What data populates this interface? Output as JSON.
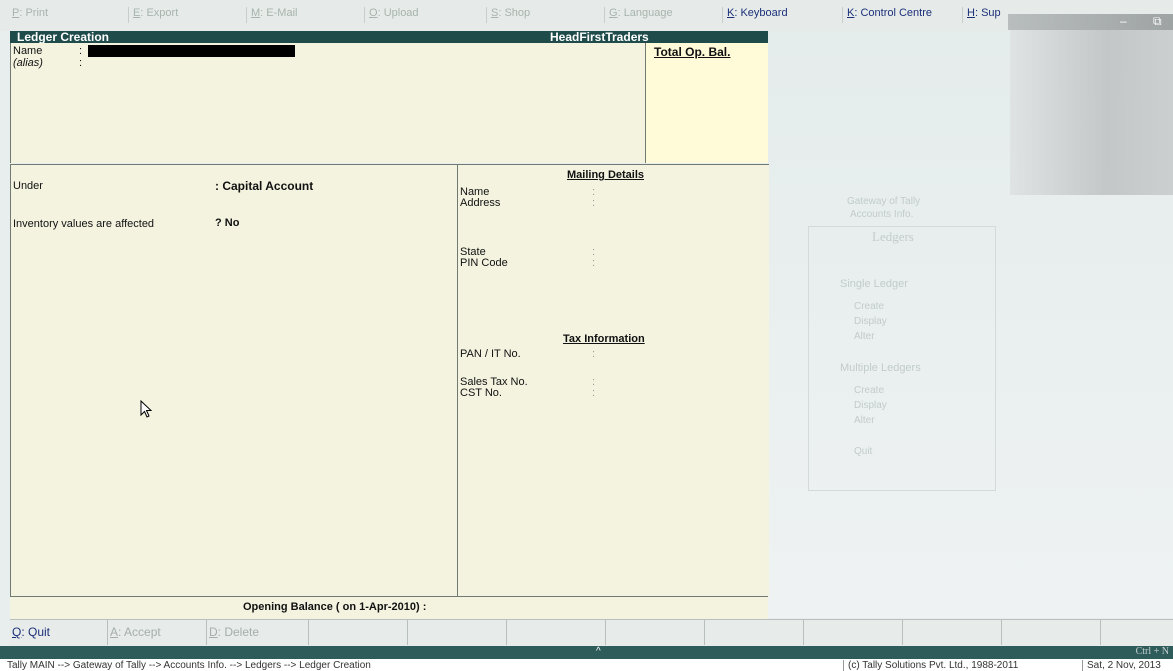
{
  "top_menu": [
    {
      "key": "P",
      "text": "Print"
    },
    {
      "key": "E",
      "text": "Export"
    },
    {
      "key": "M",
      "text": "E-Mail"
    },
    {
      "key": "O",
      "text": "Upload"
    },
    {
      "key": "S",
      "text": "Shop"
    },
    {
      "key": "G",
      "text": "Language"
    },
    {
      "key": "K",
      "text": "Keyboard"
    },
    {
      "key": "K",
      "text": "Control Centre"
    },
    {
      "key": "H",
      "text": "Sup"
    }
  ],
  "window": {
    "minimize": "–",
    "restore": "⧉"
  },
  "title": {
    "screen": "Ledger Creation",
    "company": "HeadFirstTraders"
  },
  "form": {
    "name_label": "Name",
    "alias_label": "(alias)",
    "colon": ":",
    "total_op_bal": "Total Op. Bal.",
    "under_label": "Under",
    "under_value": ": Capital Account",
    "inventory_label": "Inventory values are affected",
    "inventory_value": "? No",
    "opening_balance": "Opening Balance  ( on 1-Apr-2010) :"
  },
  "mailing": {
    "heading": "Mailing Details",
    "name": "Name",
    "address": "Address",
    "state": "State",
    "pin": "PIN Code"
  },
  "tax": {
    "heading": "Tax Information",
    "pan": "PAN / IT No.",
    "sales_tax": "Sales Tax No.",
    "cst": "CST No."
  },
  "ghost_menu": {
    "line1": "Gateway of Tally",
    "line2": "Accounts Info.",
    "title": "Ledgers",
    "single": "Single Ledger",
    "create": "Create",
    "display": "Display",
    "alter": "Alter",
    "multiple": "Multiple Ledgers",
    "mcreate": "Create",
    "mdisplay": "Display",
    "malter": "Alter",
    "quit": "Quit"
  },
  "buttons": [
    {
      "key": "Q",
      "text": ": Quit",
      "active": true
    },
    {
      "key": "A",
      "text": ": Accept",
      "active": false
    },
    {
      "key": "D",
      "text": ": Delete",
      "active": false
    }
  ],
  "status": {
    "caret": "^",
    "ctrl": "Ctrl + N",
    "path": "Tally MAIN --> Gateway of Tally --> Accounts Info. --> Ledgers --> Ledger Creation",
    "copyright": "(c) Tally Solutions Pvt. Ltd., 1988-2011",
    "date": "Sat, 2 Nov, 2013"
  },
  "colors": {
    "titlebar": "#1f4b4b",
    "pane": "#f4f3e0",
    "totalbox": "#fffbd8",
    "active_key": "#1b2f7a"
  }
}
